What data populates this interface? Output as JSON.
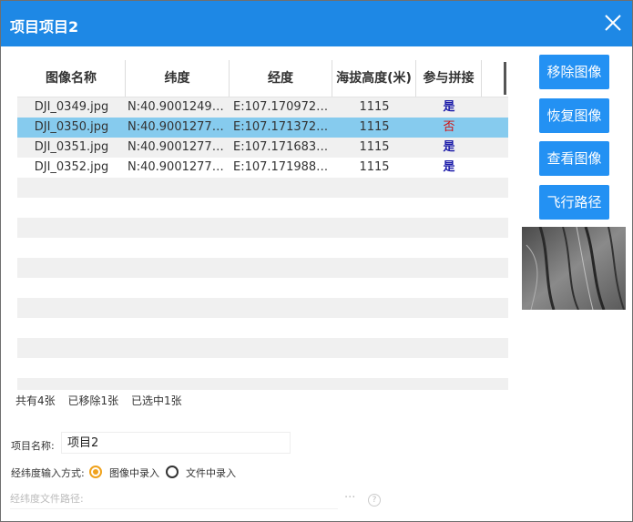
{
  "window": {
    "title": "项目项目2"
  },
  "table": {
    "columns": [
      "图像名称",
      "纬度",
      "经度",
      "海拔高度(米)",
      "参与拼接"
    ],
    "rows": [
      {
        "name": "DJI_0349.jpg",
        "lat": "N:40.900124999...",
        "lon": "E:107.17097222...",
        "alt": "1115",
        "join": "是"
      },
      {
        "name": "DJI_0350.jpg",
        "lat": "N:40.900127777...",
        "lon": "E:107.17137222...",
        "alt": "1115",
        "join": "否"
      },
      {
        "name": "DJI_0351.jpg",
        "lat": "N:40.900127777...",
        "lon": "E:107.17168333...",
        "alt": "1115",
        "join": "是"
      },
      {
        "name": "DJI_0352.jpg",
        "lat": "N:40.900127777...",
        "lon": "E:107.17198888...",
        "alt": "1115",
        "join": "是"
      }
    ],
    "selected_row": 1
  },
  "status": {
    "total": "共有4张",
    "removed": "已移除1张",
    "selected": "已选中1张"
  },
  "buttons": {
    "remove": "移除图像",
    "restore": "恢复图像",
    "view": "查看图像",
    "flight_path": "飞行路径"
  },
  "form": {
    "project_name_label": "项目名称:",
    "project_name_value": "项目2",
    "coord_mode_label": "经纬度输入方式:",
    "option_image": "图像中录入",
    "option_file": "文件中录入",
    "selected_option": "image",
    "file_path_placeholder": "经纬度文件路径:",
    "browse_label": "···",
    "help_label": "?"
  },
  "colors": {
    "titlebar": "#1e88e5",
    "button": "#2391f3",
    "selected_row": "#86cbee",
    "yes_text": "#1a1aa8",
    "no_text": "#d21010",
    "radio_on": "#f0a21c"
  },
  "icons": {
    "close": "close-icon",
    "preview": "image-preview",
    "help": "help-icon"
  }
}
